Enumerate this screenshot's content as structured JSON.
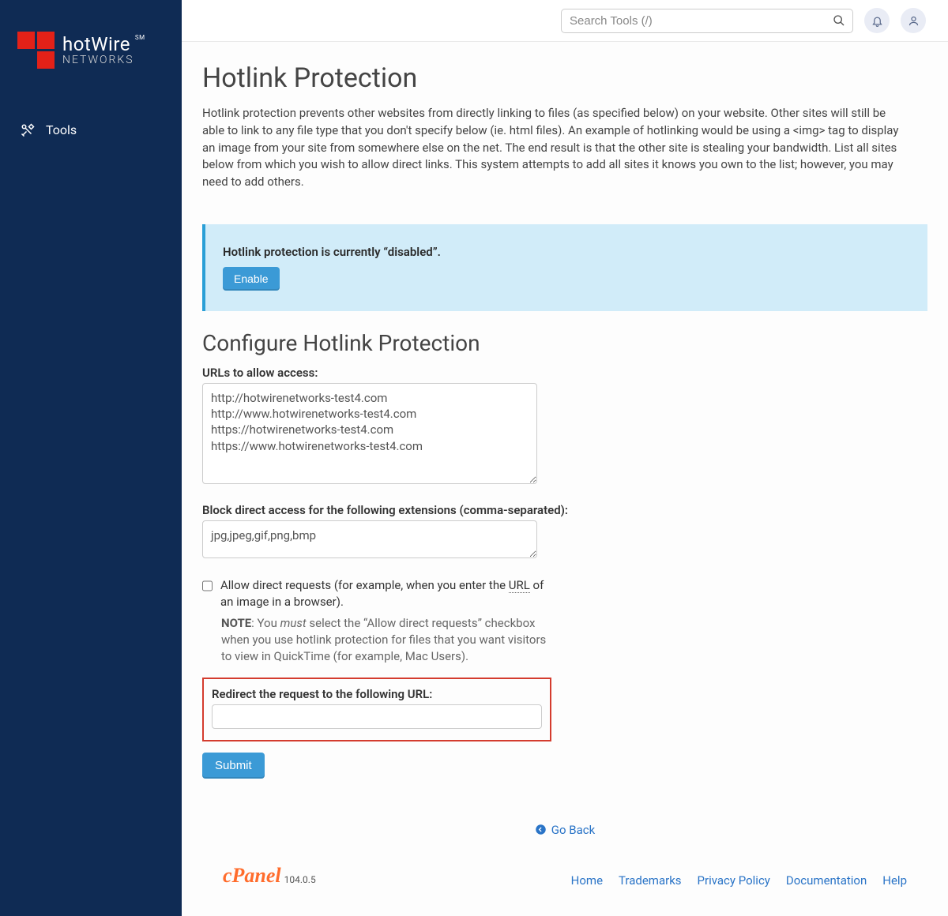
{
  "brand": {
    "name_html_line1": "hotWire",
    "sm": "SM",
    "line2": "NETWORKS"
  },
  "sidebar": {
    "tools_label": "Tools"
  },
  "topbar": {
    "search_placeholder": "Search Tools (/)"
  },
  "page": {
    "title": "Hotlink Protection",
    "description": "Hotlink protection prevents other websites from directly linking to files (as specified below) on your website. Other sites will still be able to link to any file type that you don't specify below (ie. html files). An example of hotlinking would be using a <img> tag to display an image from your site from somewhere else on the net. The end result is that the other site is stealing your bandwidth. List all sites below from which you wish to allow direct links. This system attempts to add all sites it knows you own to the list; however, you may need to add others.",
    "alert_status": "Hotlink protection is currently “disabled”.",
    "enable_button": "Enable",
    "config_heading": "Configure Hotlink Protection",
    "urls_label": "URLs to allow access:",
    "urls_value": "http://hotwirenetworks-test4.com\nhttp://www.hotwirenetworks-test4.com\nhttps://hotwirenetworks-test4.com\nhttps://www.hotwirenetworks-test4.com",
    "ext_label": "Block direct access for the following extensions (comma-separated):",
    "ext_value": "jpg,jpeg,gif,png,bmp",
    "allow_direct_prefix": "Allow direct requests (for example, when you enter the ",
    "allow_direct_url_abbrev": "URL",
    "allow_direct_suffix": " of an image in a browser).",
    "note_label": "NOTE",
    "note_prefix": ": You ",
    "note_emph": "must",
    "note_rest": " select the “Allow direct requests” checkbox when you use hotlink protection for files that you want visitors to view in QuickTime (for example, Mac Users).",
    "redirect_label": "Redirect the request to the following URL:",
    "submit_label": "Submit",
    "goback_label": "Go Back"
  },
  "footer": {
    "cpanel": "cPanel",
    "version": "104.0.5",
    "links": [
      "Home",
      "Trademarks",
      "Privacy Policy",
      "Documentation",
      "Help"
    ]
  }
}
